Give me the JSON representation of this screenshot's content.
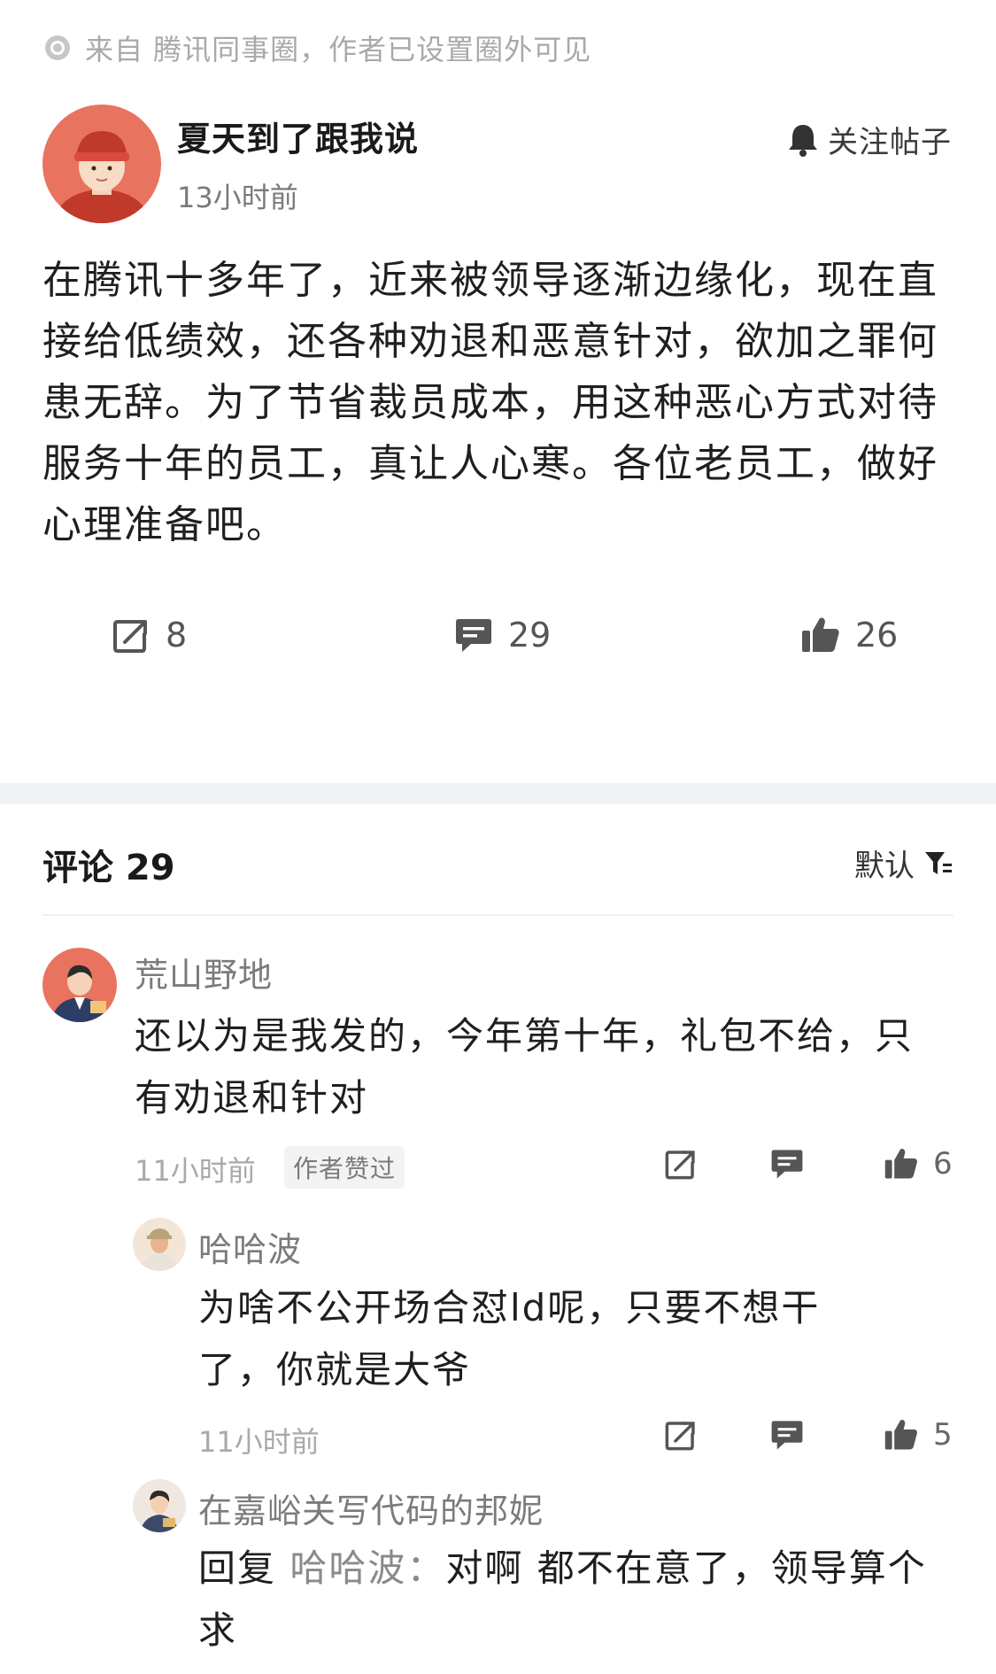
{
  "source": {
    "text": "来自 腾讯同事圈，作者已设置圈外可见"
  },
  "post": {
    "author": "夏天到了跟我说",
    "time": "13小时前",
    "follow_label": "关注帖子",
    "body": "在腾讯十多年了，近来被领导逐渐边缘化，现在直接给低绩效，还各种劝退和恶意针对，欲加之罪何患无辞。为了节省裁员成本，用这种恶心方式对待服务十年的员工，真让人心寒。各位老员工，做好心理准备吧。",
    "shares": "8",
    "comments": "29",
    "likes": "26"
  },
  "comments_header": {
    "title": "评论 29",
    "sort_label": "默认"
  },
  "comments": [
    {
      "name": "荒山野地",
      "text": "还以为是我发的，今年第十年，礼包不给，只有劝退和针对",
      "time": "11小时前",
      "badge": "作者赞过",
      "likes": "6"
    },
    {
      "name": "哈哈波",
      "text": "为啥不公开场合怼ld呢，只要不想干了，你就是大爷",
      "time": "11小时前",
      "likes": "5"
    },
    {
      "name": "在嘉峪关写代码的邦妮",
      "reply_prefix": "回复 ",
      "reply_target": "哈哈波：",
      "text": "对啊 都不在意了，领导算个求"
    }
  ],
  "colors": {
    "text": "#1f1f1f",
    "muted": "#a9a9a9",
    "divider": "#f1f2f5",
    "avatar_bg": "#e8735f"
  },
  "icons": [
    "location-dot-icon",
    "bell-icon",
    "share-icon",
    "comment-icon",
    "thumbs-up-icon",
    "filter-icon"
  ]
}
